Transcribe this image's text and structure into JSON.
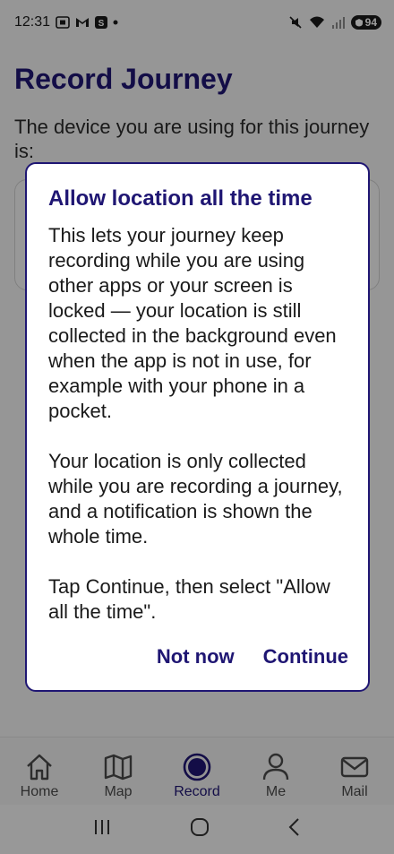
{
  "status_bar": {
    "time": "12:31",
    "battery": "94",
    "left_icons": [
      "screenshot-icon",
      "gmail-icon",
      "app-icon",
      "dot-icon"
    ],
    "right_icons": [
      "mute-icon",
      "wifi-icon",
      "signal-icon",
      "battery-icon"
    ]
  },
  "page": {
    "title": "Record Journey",
    "device_text": "The device you are using for this journey is:"
  },
  "dialog": {
    "title": "Allow location all the time",
    "paragraphs": [
      "This lets your journey keep recording while you are using other apps or your screen is locked — your location is still collected in the background even when the app is not in use, for example with your phone in a pocket.",
      "Your location is only collected while you are recording a journey, and a notification is shown the whole time.",
      "Tap Continue, then select \"Allow all the time\"."
    ],
    "buttons": {
      "secondary": "Not now",
      "primary": "Continue"
    }
  },
  "bottom_nav": {
    "items": [
      {
        "label": "Home",
        "icon": "home-icon"
      },
      {
        "label": "Map",
        "icon": "map-icon"
      },
      {
        "label": "Record",
        "icon": "record-icon",
        "active": true
      },
      {
        "label": "Me",
        "icon": "person-icon"
      },
      {
        "label": "Mail",
        "icon": "mail-icon"
      }
    ]
  },
  "android_nav": {
    "buttons": [
      "recents-icon",
      "home-circle-icon",
      "back-icon"
    ]
  },
  "colors": {
    "accent": "#1f1673",
    "scrim": "rgba(0,0,0,0.38)"
  }
}
